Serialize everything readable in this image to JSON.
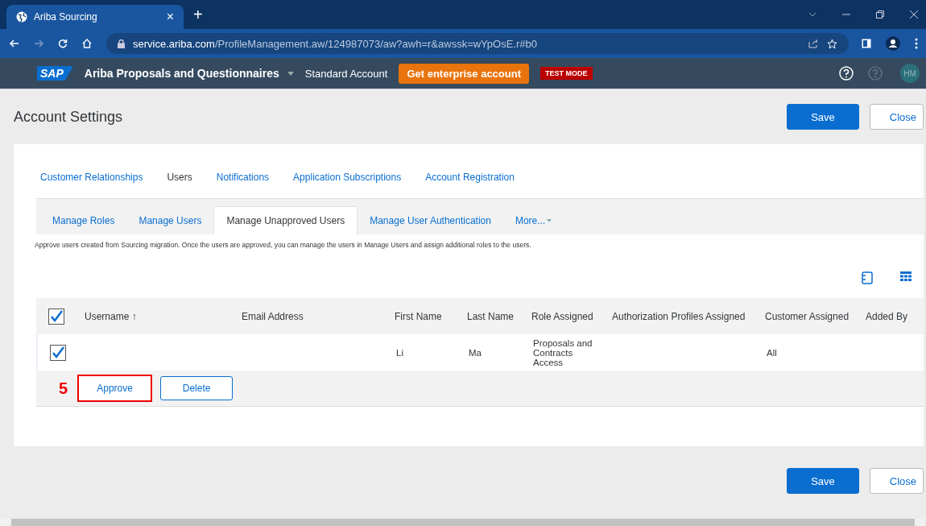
{
  "browser": {
    "tab_title": "Ariba Sourcing",
    "tab_close": "×",
    "new_tab": "+",
    "url_host": "service.ariba.com",
    "url_path": "/ProfileManagement.aw/124987073/aw?awh=r&awssk=wYpOsE.r#b0"
  },
  "header": {
    "logo": "SAP",
    "product": "Ariba Proposals and Questionnaires",
    "account": "Standard Account",
    "upgrade_button": "Get enterprise account",
    "mode_badge": "TEST MODE",
    "avatar": "HM"
  },
  "page_title": "Account Settings",
  "top_buttons": [
    "Save",
    "Close"
  ],
  "tabs": [
    {
      "label": "Customer Relationships",
      "selected": false
    },
    {
      "label": "Users",
      "selected": true
    },
    {
      "label": "Notifications",
      "selected": false
    },
    {
      "label": "Application Subscriptions",
      "selected": false
    },
    {
      "label": "Account Registration",
      "selected": false
    }
  ],
  "subtabs": [
    {
      "label": "Manage Roles",
      "selected": false
    },
    {
      "label": "Manage Users",
      "selected": false
    },
    {
      "label": "Manage Unapproved Users",
      "selected": true
    },
    {
      "label": "Manage User Authentication",
      "selected": false
    },
    {
      "label": "More...",
      "selected": false
    }
  ],
  "description": "Approve users created from Sourcing migration. Once the users are approved, you can manage the users in Manage Users and assign additional roles to the users.",
  "table": {
    "select_all": {
      "checked": true
    },
    "columns": [
      "Username ↑",
      "Email Address",
      "First Name",
      "Last Name",
      "Role Assigned",
      "Authorization Profiles Assigned",
      "Customer Assigned",
      "Added By"
    ],
    "rows": [
      {
        "checked": true,
        "cells": [
          "",
          "",
          "Li",
          "Ma",
          "Proposals and Contracts Access",
          "",
          "All",
          ""
        ]
      }
    ]
  },
  "actions": [
    {
      "label": "Approve",
      "highlighted": true
    },
    {
      "label": "Delete",
      "highlighted": false
    }
  ],
  "annotation": "5",
  "bottom_buttons": [
    "Save",
    "Close"
  ]
}
